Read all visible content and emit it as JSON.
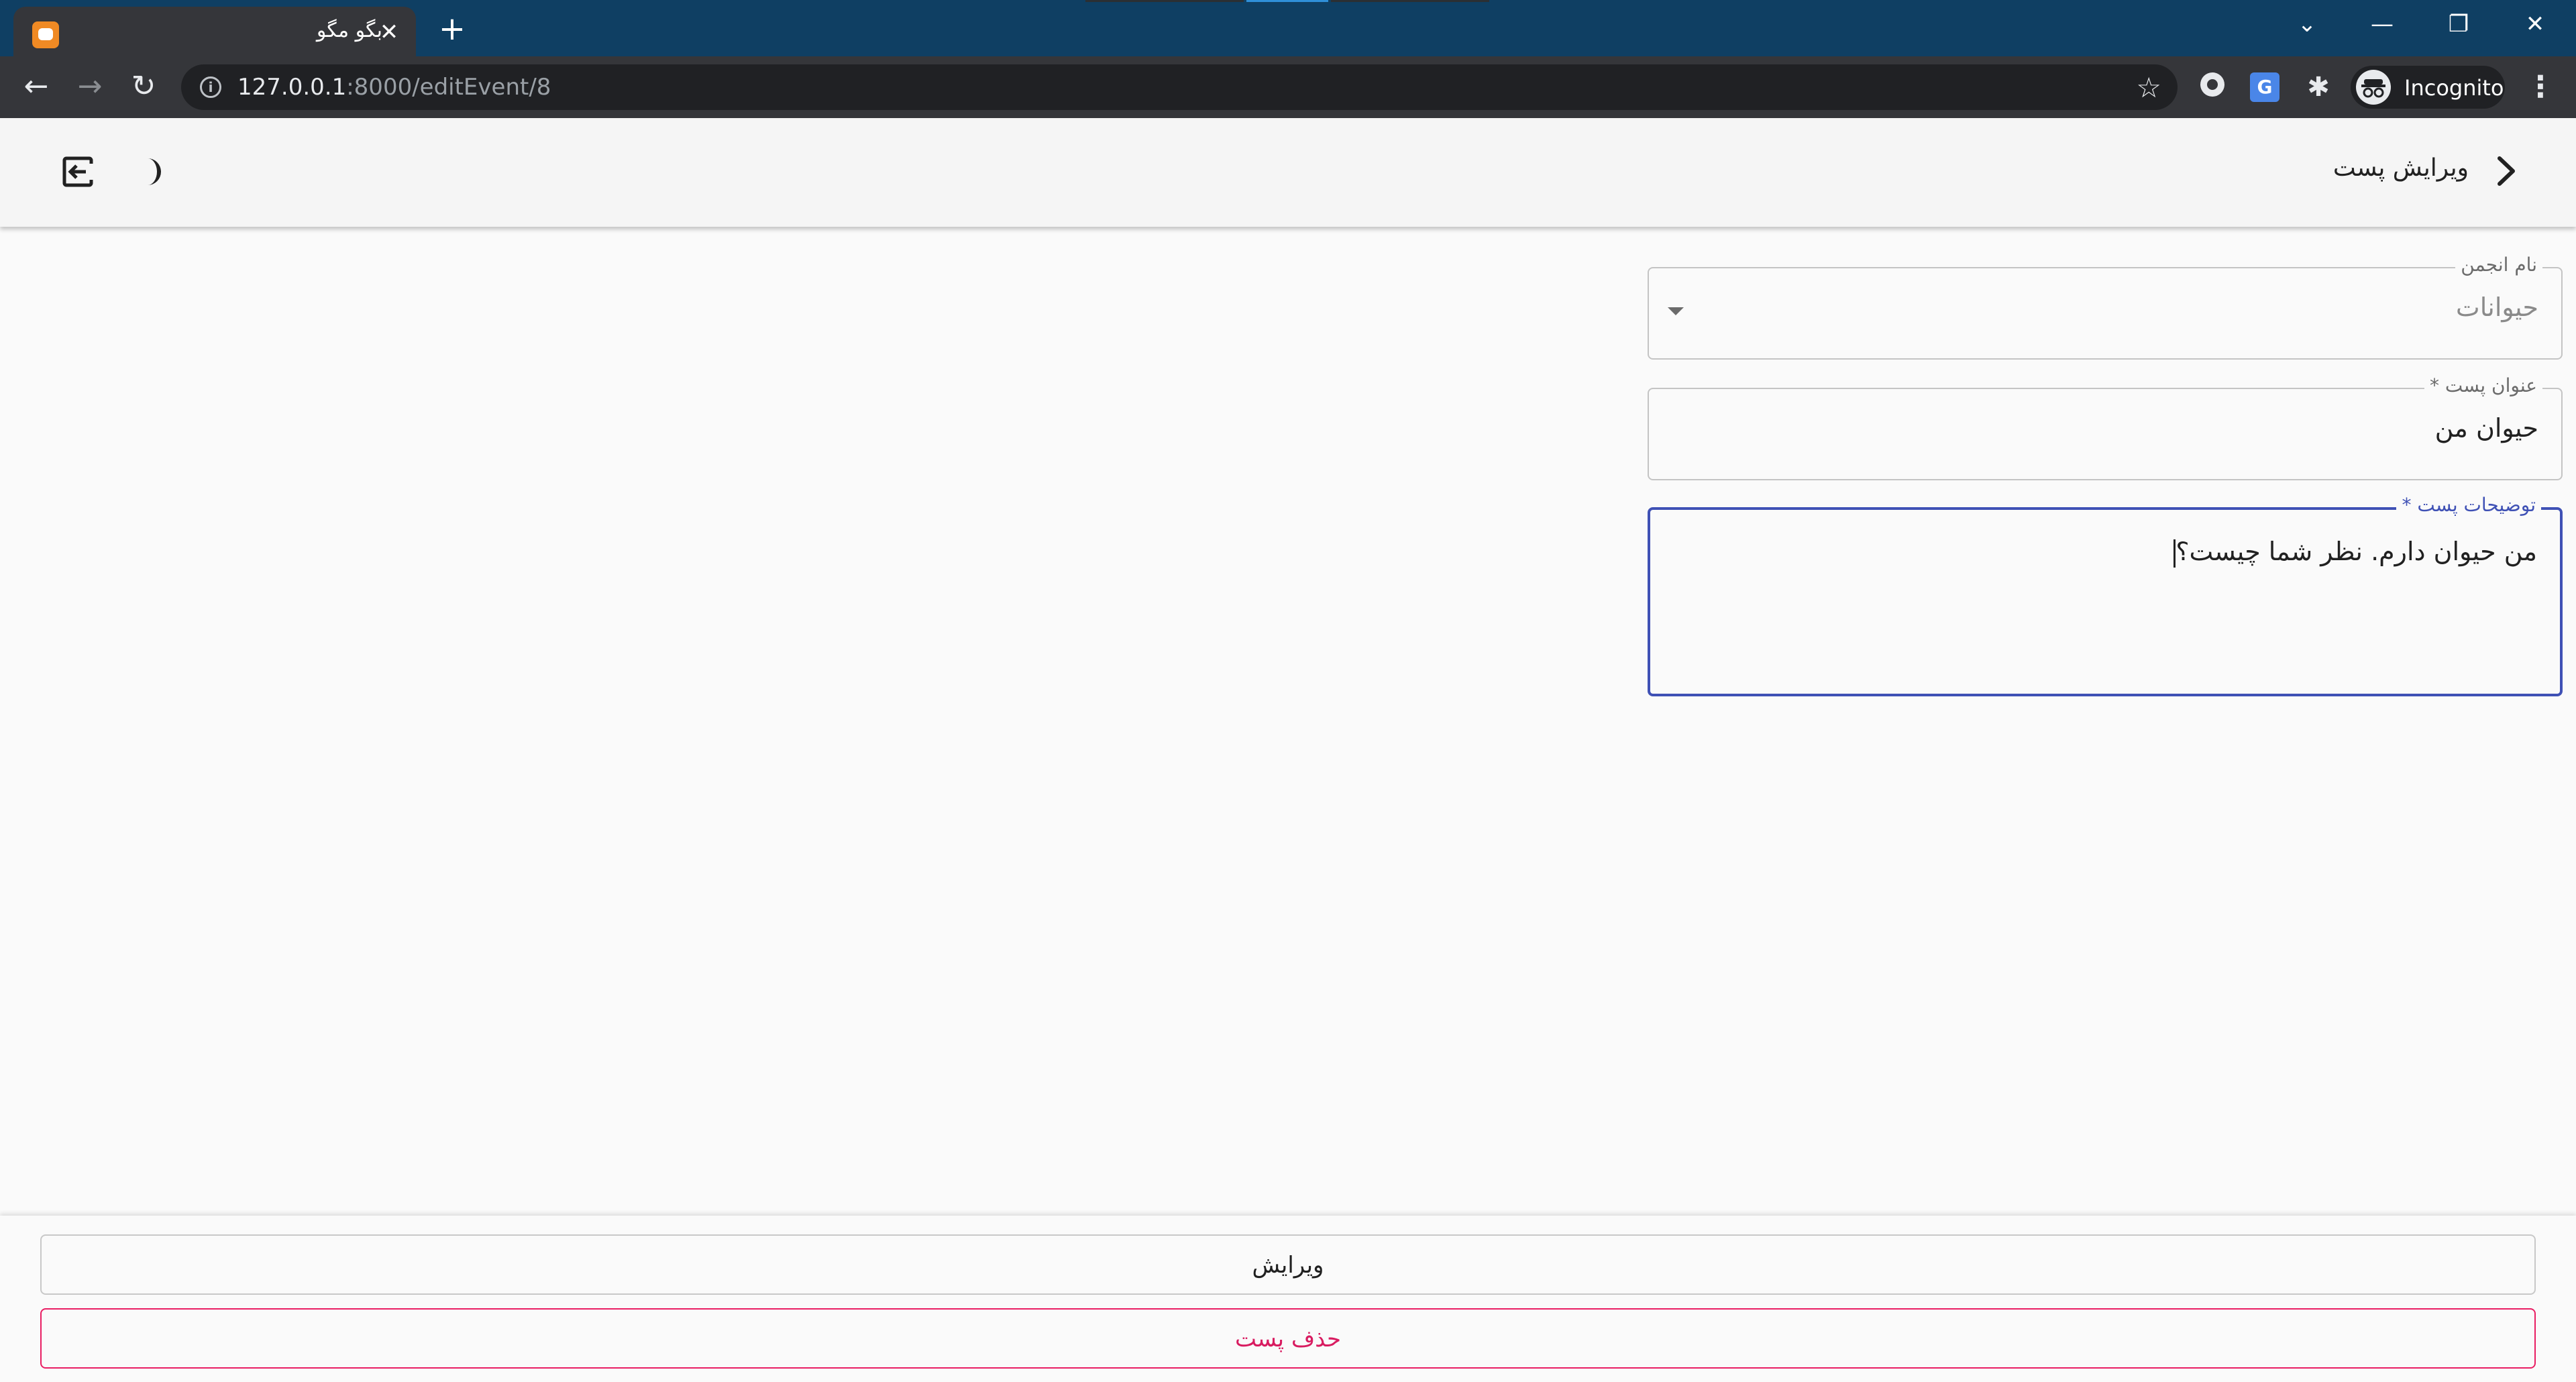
{
  "browser": {
    "tab_title": "بگو مگو",
    "tab_close_glyph": "✕",
    "new_tab_glyph": "+",
    "url_host": "127.0.0.1",
    "url_path": ":8000/editEvent/8",
    "profile_label": "Incognito",
    "window_controls": {
      "dropdown": "⌄",
      "minimize": "—",
      "restore": "❐",
      "close": "✕"
    },
    "nav_glyphs": {
      "back": "←",
      "forward": "→",
      "reload": "↻",
      "star": "☆",
      "extension": "✱",
      "menu": "⋮",
      "info": "i"
    },
    "colors": {
      "titlebar": "#0f3f63",
      "toolbar": "#35363a",
      "omnibox": "#202124"
    }
  },
  "header": {
    "title": "ویرایش پست",
    "icons": [
      "chevron-right-icon",
      "logout-icon",
      "moon-icon"
    ]
  },
  "form": {
    "community": {
      "label": "نام انجمن",
      "value": "حیوانات"
    },
    "post_title": {
      "label": "عنوان پست *",
      "value": "حیوان من"
    },
    "post_description": {
      "label": "توضیحات پست *",
      "value": "من حیوان دارم. نظر شما چیست؟"
    }
  },
  "actions": {
    "edit_label": "ویرایش",
    "delete_label": "حذف پست"
  },
  "theme": {
    "accent": "#3f51b5",
    "danger": "#e91e63",
    "background": "#fafafa"
  }
}
